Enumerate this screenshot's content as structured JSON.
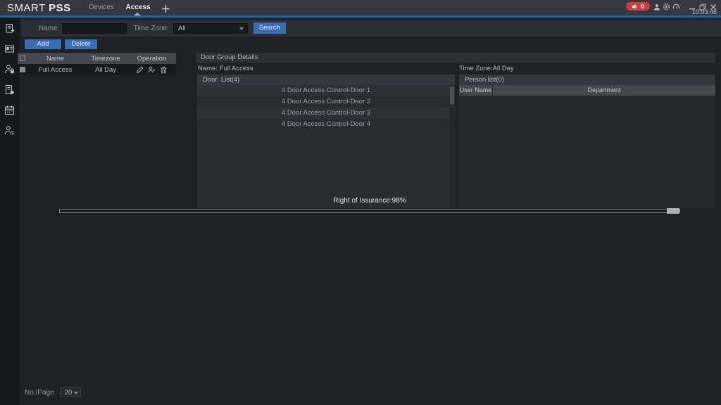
{
  "titlebar": {
    "logo_part1": "SMART",
    "logo_part2": "PSS",
    "tabs": [
      {
        "label": "Devices",
        "active": false
      },
      {
        "label": "Access",
        "active": true
      }
    ],
    "alarm_count": "0",
    "clock": "10:03:46",
    "icons": [
      "speaker-icon",
      "user-icon",
      "gear-icon",
      "gauge-icon",
      "minimize-icon",
      "restore-icon",
      "close-icon"
    ]
  },
  "sidebar": {
    "icons": [
      "console-icon",
      "id-card-icon",
      "user-permission-icon",
      "file-permission-icon",
      "calendar-icon",
      "user-settings-icon"
    ]
  },
  "search_bar": {
    "name_label": "Name",
    "name_value": "",
    "timezone_label": "Time Zone:",
    "timezone_value": "All",
    "search_button": "Search"
  },
  "group_table": {
    "add_button": "Add",
    "delete_button": "Delete",
    "columns": [
      "Name",
      "Timezone",
      "Operation"
    ],
    "rows": [
      {
        "name": "Full Access",
        "timezone": "All Day",
        "operations": [
          "edit-icon",
          "assign-person-icon",
          "delete-icon"
        ]
      }
    ],
    "page_label": "No./Page",
    "page_size": "20"
  },
  "details": {
    "title": "Door Group Details",
    "name_line": "Name: Full Access",
    "timezone_line": "Time Zone:All Day",
    "door_list_header": "Door  List(4)",
    "doors": [
      "4 Door Access Control-Door 1",
      "4 Door Access Control-Door 2",
      "4 Door Access Control-Door 3",
      "4 Door Access Control-Door 4"
    ],
    "person_list_header": "Person list(0)",
    "person_columns": [
      "User Name",
      "Department"
    ]
  },
  "progress": {
    "label": "Right of Issurance:98%",
    "percent": 98
  },
  "colors": {
    "accent_blue": "#2064ac",
    "button_blue": "#3a6db4",
    "badge_red": "#cf3a40",
    "titlebar_bg": "#35383d",
    "window_bg": "#1e2125",
    "panel_bg": "#292c31",
    "table_header_bg": "#44484e"
  }
}
